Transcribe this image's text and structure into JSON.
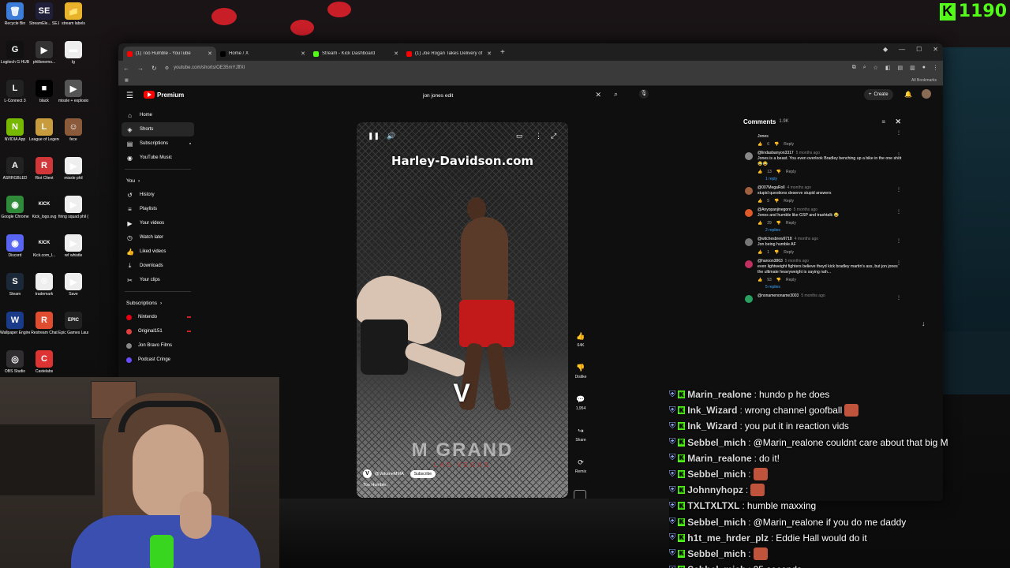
{
  "desktop": {
    "icons": [
      {
        "label": "Recycle Bin",
        "color": "#3b7dd8",
        "glyph": "🗑"
      },
      {
        "label": "StreamEle... SE.Live",
        "color": "#1f1f3a",
        "glyph": "SE"
      },
      {
        "label": "stream labels",
        "color": "#e8b32a",
        "glyph": "📁"
      },
      {
        "label": "Logitech G HUB",
        "color": "#111111",
        "glyph": "G"
      },
      {
        "label": "phlilonemo...",
        "color": "#333333",
        "glyph": "▶"
      },
      {
        "label": "lg",
        "color": "#eeeeee",
        "glyph": "▬"
      },
      {
        "label": "L-Connect 3",
        "color": "#222222",
        "glyph": "L"
      },
      {
        "label": "black",
        "color": "#000000",
        "glyph": "■"
      },
      {
        "label": "missle + explosion ...",
        "color": "#555555",
        "glyph": "▶"
      },
      {
        "label": "NVIDIA App",
        "color": "#76b900",
        "glyph": "N"
      },
      {
        "label": "League of Legends",
        "color": "#c89b3c",
        "glyph": "L"
      },
      {
        "label": "fece",
        "color": "#8a5a3a",
        "glyph": "☺"
      },
      {
        "label": "ASRRGBLED",
        "color": "#222222",
        "glyph": "A"
      },
      {
        "label": "Riot Client",
        "color": "#d13639",
        "glyph": "R"
      },
      {
        "label": "missle phil",
        "color": "#eeeeee",
        "glyph": "▶"
      },
      {
        "label": "Google Chrome",
        "color": "#2f8a3a",
        "glyph": "◉"
      },
      {
        "label": "Kick_logo.svg",
        "color": "#111111",
        "glyph": "KICK"
      },
      {
        "label": "firing squad phil (1)",
        "color": "#eeeeee",
        "glyph": "▶"
      },
      {
        "label": "Discord",
        "color": "#5865f2",
        "glyph": "◉"
      },
      {
        "label": "Kick.com_l...",
        "color": "#111111",
        "glyph": "KICK"
      },
      {
        "label": "ref whistle",
        "color": "#eeeeee",
        "glyph": "▶"
      },
      {
        "label": "Steam",
        "color": "#1b2838",
        "glyph": "S"
      },
      {
        "label": "trademark",
        "color": "#eeeeee",
        "glyph": "®"
      },
      {
        "label": "Save",
        "color": "#eeeeee",
        "glyph": "▶"
      },
      {
        "label": "Wallpaper Engine",
        "color": "#1a3a8a",
        "glyph": "W"
      },
      {
        "label": "Restream Chat",
        "color": "#e04c2f",
        "glyph": "R"
      },
      {
        "label": "Epic Games Launcher",
        "color": "#222222",
        "glyph": "EPIC"
      },
      {
        "label": "OBS Studio",
        "color": "#302e31",
        "glyph": "◎"
      },
      {
        "label": "Castelabs",
        "color": "#d33",
        "glyph": "C"
      }
    ],
    "kick_count": "1190",
    "kick_logo_letter": "K",
    "colors": {
      "kick_green": "#53fc18",
      "red": "#c81e28"
    }
  },
  "browser": {
    "tabs": [
      {
        "title": "(1) Too Humble - YouTube",
        "color": "#ff0000",
        "active": true
      },
      {
        "title": "Home / X",
        "color": "#000000",
        "active": false
      },
      {
        "title": "Stream - Kick Dashboard",
        "color": "#53fc18",
        "active": false
      },
      {
        "title": "(1) Joe Rogan Takes Delivery of",
        "color": "#ff0000",
        "active": false
      }
    ],
    "url": "youtube.com/shorts/OE35mYJffXI",
    "bookmarks_label": "All Bookmarks"
  },
  "youtube": {
    "logo_text": "Premium",
    "search_query": "jon jones edit",
    "create_label": "Create",
    "sidebar": {
      "main": [
        {
          "label": "Home",
          "icon": "⌂"
        },
        {
          "label": "Shorts",
          "icon": "◈"
        },
        {
          "label": "Subscriptions",
          "icon": "▤"
        },
        {
          "label": "YouTube Music",
          "icon": "◉"
        }
      ],
      "you_label": "You",
      "you": [
        {
          "label": "History",
          "icon": "↺"
        },
        {
          "label": "Playlists",
          "icon": "≡"
        },
        {
          "label": "Your videos",
          "icon": "▶"
        },
        {
          "label": "Watch later",
          "icon": "◷"
        },
        {
          "label": "Liked videos",
          "icon": "👍"
        },
        {
          "label": "Downloads",
          "icon": "⤓"
        },
        {
          "label": "Your clips",
          "icon": "✂"
        }
      ],
      "subscriptions_label": "Subscriptions",
      "subscriptions": [
        {
          "label": "Nintendo",
          "color": "#e60012"
        },
        {
          "label": "Original151",
          "color": "#e04040"
        },
        {
          "label": "Jon Bravo Films",
          "color": "#888888"
        },
        {
          "label": "Podcast Cringe",
          "color": "#6a4cff"
        }
      ]
    },
    "short": {
      "banner": "Harley-Davidson.com",
      "mat_text": "M GRAND",
      "mat_sub": "LAS VEGAS",
      "logo": "V",
      "channel": "@VolumeMMA",
      "subscribe": "Subscribe",
      "title": "Too Humble.",
      "channel_initial": "V"
    },
    "actions": [
      {
        "icon": "👍",
        "label": "64K"
      },
      {
        "icon": "👎",
        "label": "Dislike"
      },
      {
        "icon": "💬",
        "label": "1,954"
      },
      {
        "icon": "↪",
        "label": "Share"
      },
      {
        "icon": "⟳",
        "label": "Remix"
      }
    ],
    "comments": {
      "title": "Comments",
      "count": "1.9K",
      "items": [
        {
          "author": "",
          "when": "",
          "text": "Jones",
          "likes": "6",
          "reply": "Reply",
          "color": "#777777",
          "replies": ""
        },
        {
          "author": "@lindasbanyon3317",
          "when": "5 months ago",
          "text": "Jones is a beast. You even overlook Bradley benching up a bike in the one shot 😂😂",
          "likes": "13",
          "reply": "Reply",
          "color": "#888888",
          "replies": "1 reply"
        },
        {
          "author": "@007MegaRoll",
          "when": "4 months ago",
          "text": "stupid questions deserve stupid answers",
          "likes": "5",
          "reply": "Reply",
          "color": "#a06040",
          "replies": ""
        },
        {
          "author": "@Anyopanjinegoro",
          "when": "5 months ago",
          "text": "Jones and humble like GSP and trashtalk 😂",
          "likes": "29",
          "reply": "Reply",
          "color": "#e05a2a",
          "replies": "2 replies"
        },
        {
          "author": "@witchesbrew9718",
          "when": "4 months ago",
          "text": "Jon being humble AF",
          "likes": "1",
          "reply": "Reply",
          "color": "#777777",
          "replies": ""
        },
        {
          "author": "@haroon3863",
          "when": "5 months ago",
          "text": "even lightweight fighters believe theyd kick bradley martin's ass, but jon jones the ultimate heavyweight is saying nah...",
          "likes": "93",
          "reply": "Reply",
          "color": "#c03060",
          "replies": "5 replies"
        },
        {
          "author": "@nonamenoname3003",
          "when": "5 months ago",
          "text": "",
          "likes": "",
          "reply": "",
          "color": "#2aa060",
          "replies": ""
        }
      ]
    }
  },
  "chat": [
    {
      "user": "Marin_realone",
      "color": "#d9d9d9",
      "msg": "hundo p he does",
      "emote": false
    },
    {
      "user": "Ink_Wizard",
      "color": "#d9d9d9",
      "msg": "wrong channel goofball",
      "emote": true
    },
    {
      "user": "Ink_Wizard",
      "color": "#d9d9d9",
      "msg": "you put it in reaction vids",
      "emote": false
    },
    {
      "user": "Sebbel_mich",
      "color": "#d9d9d9",
      "msg": "@Marin_realone couldnt care about that big M",
      "emote": false
    },
    {
      "user": "Marin_realone",
      "color": "#d9d9d9",
      "msg": "do it!",
      "emote": false
    },
    {
      "user": "Sebbel_mich",
      "color": "#d9d9d9",
      "msg": "",
      "emote": true
    },
    {
      "user": "Johnnyhopz",
      "color": "#d9d9d9",
      "msg": "",
      "emote": true
    },
    {
      "user": "TXLTXLTXL",
      "color": "#d9d9d9",
      "msg": "humble maxxing",
      "emote": false
    },
    {
      "user": "Sebbel_mich",
      "color": "#d9d9d9",
      "msg": "@Marin_realone if you do me daddy",
      "emote": false
    },
    {
      "user": "h1t_me_hrder_plz",
      "color": "#d9d9d9",
      "msg": "Eddie Hall would do it",
      "emote": false
    },
    {
      "user": "Sebbel_mich",
      "color": "#d9d9d9",
      "msg": "",
      "emote": true
    },
    {
      "user": "Sebbel_mich",
      "color": "#d9d9d9",
      "msg": "25 seconds",
      "emote": false
    }
  ]
}
